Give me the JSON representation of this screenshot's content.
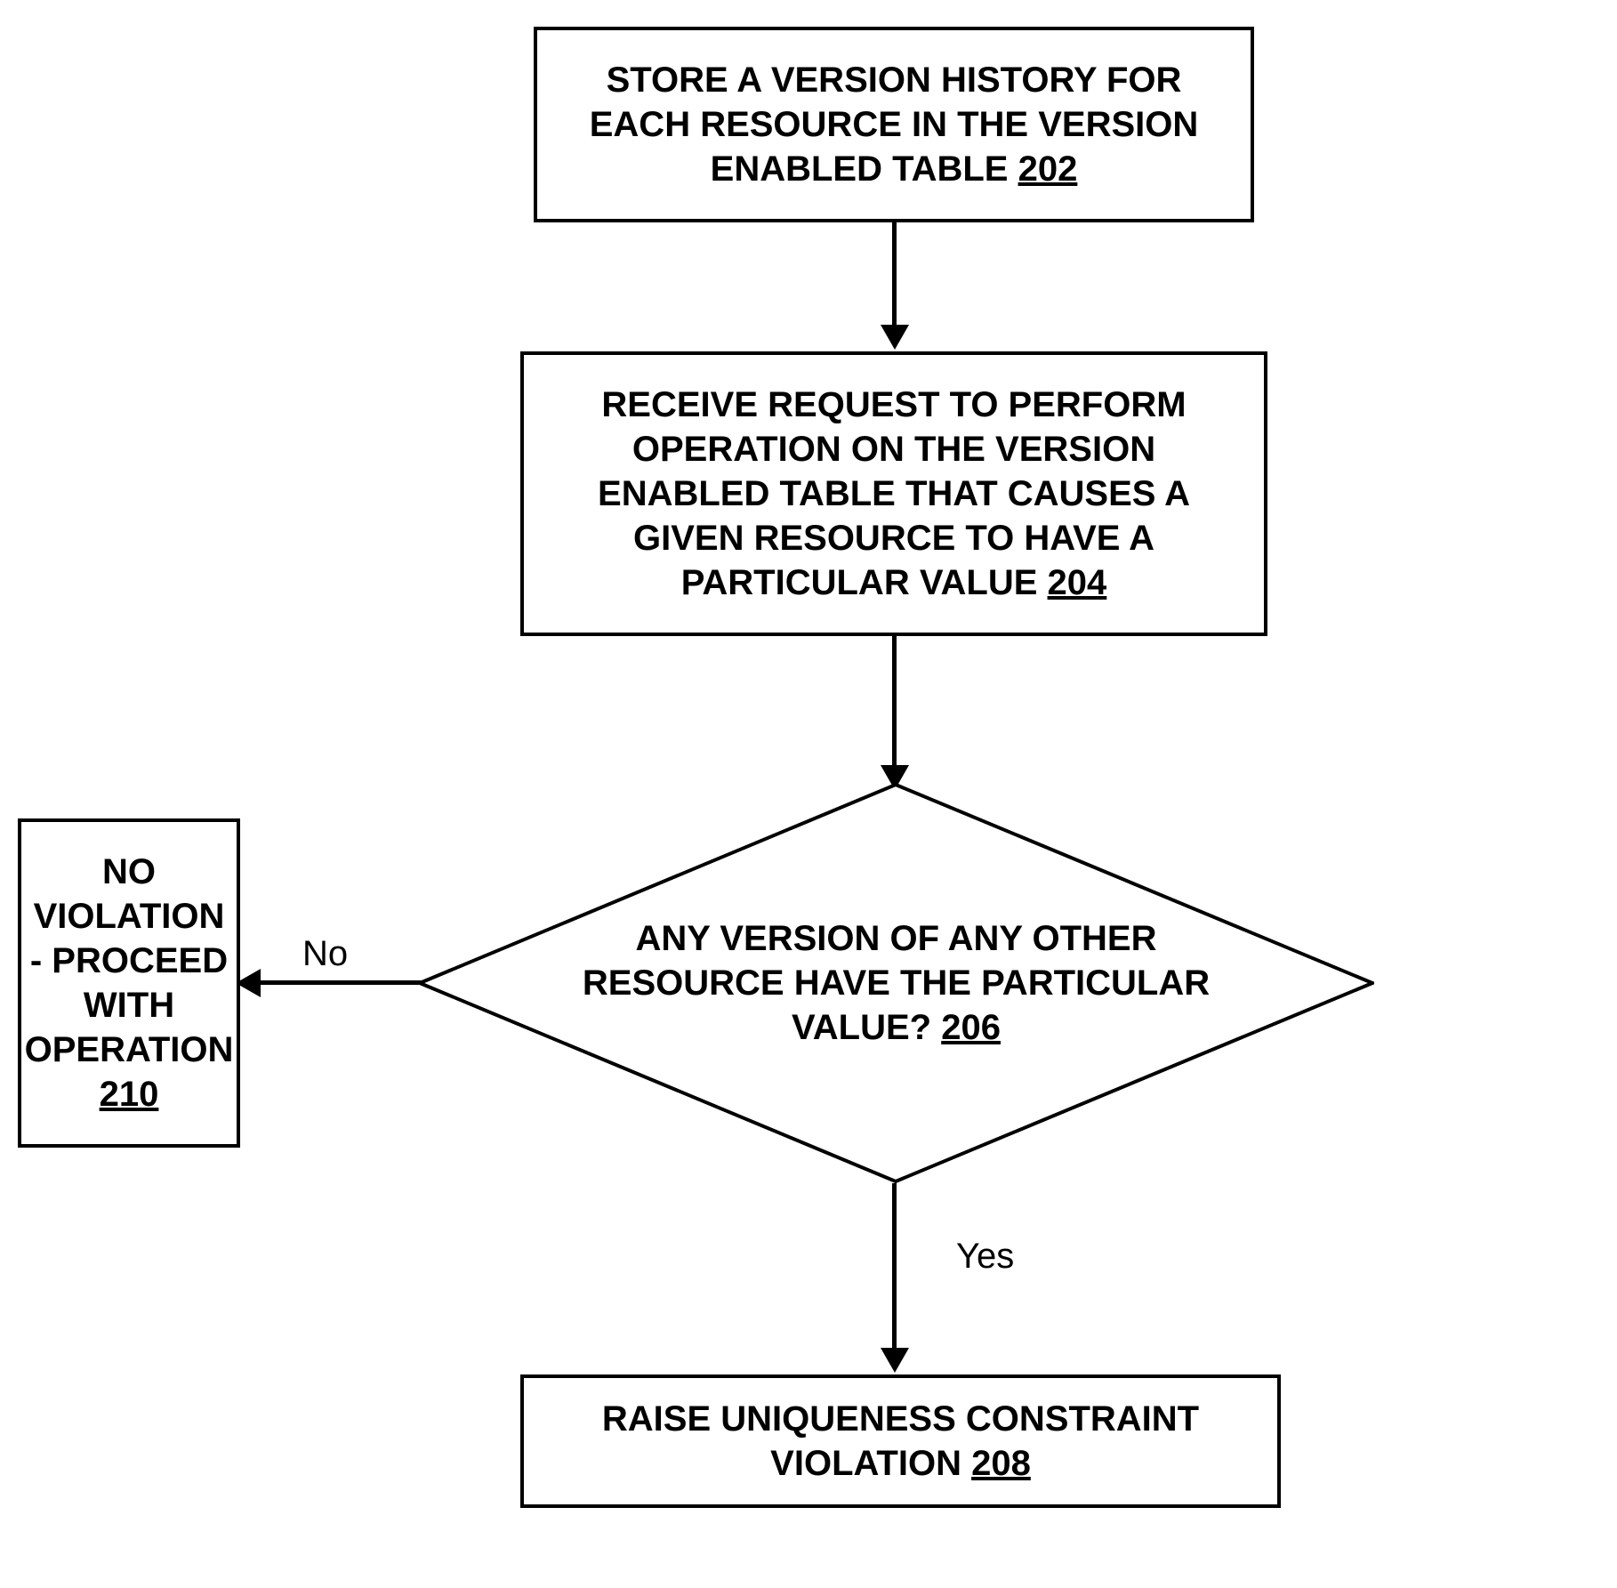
{
  "nodes": {
    "step202": {
      "text": "STORE A VERSION HISTORY FOR EACH RESOURCE IN THE VERSION ENABLED TABLE",
      "ref": "202"
    },
    "step204": {
      "text": "RECEIVE REQUEST TO PERFORM OPERATION ON THE VERSION ENABLED TABLE THAT CAUSES A GIVEN RESOURCE TO HAVE A PARTICULAR VALUE",
      "ref": "204"
    },
    "decision206": {
      "text": "ANY VERSION OF ANY OTHER RESOURCE HAVE THE PARTICULAR VALUE?",
      "ref": "206"
    },
    "step208": {
      "text": "RAISE UNIQUENESS CONSTRAINT VIOLATION",
      "ref": "208"
    },
    "step210": {
      "text": "NO VIOLATION - PROCEED WITH OPERATION",
      "ref": "210"
    }
  },
  "labels": {
    "no": "No",
    "yes": "Yes"
  }
}
